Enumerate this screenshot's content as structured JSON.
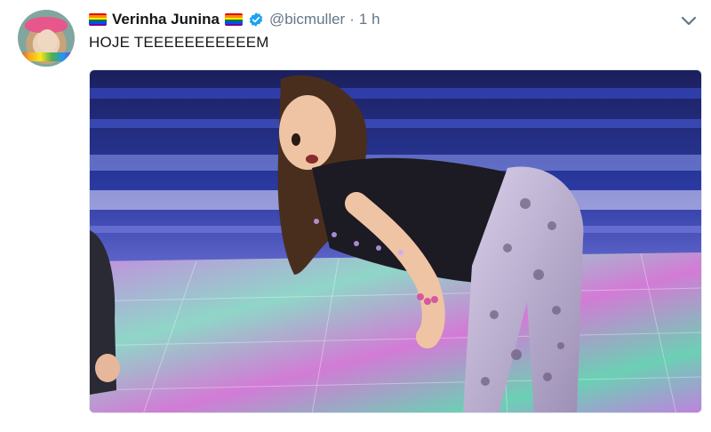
{
  "tweet": {
    "display_name": "Verinha Junina",
    "handle": "@bicmuller",
    "separator": "·",
    "time": "1 h",
    "text": "HOJE TEEEEEEEEEEEM",
    "icons": {
      "flag": "rainbow-flag-icon",
      "verified": "verified-badge-icon",
      "menu": "chevron-down-icon"
    },
    "colors": {
      "name": "#14171a",
      "muted": "#657786",
      "verified": "#1da1f2"
    },
    "media": {
      "description": "Photo of a dancer on a colorful lit stage"
    }
  }
}
